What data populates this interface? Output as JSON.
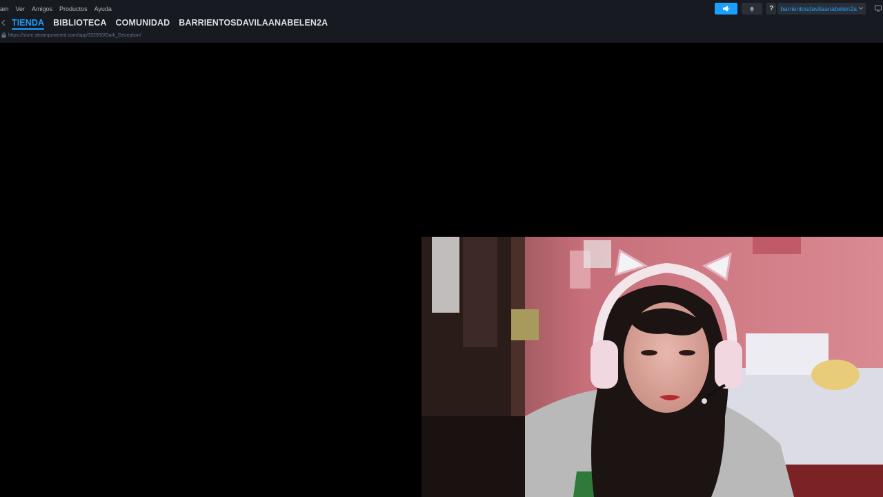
{
  "menu": {
    "items": [
      "am",
      "Ver",
      "Amigos",
      "Productos",
      "Ayuda"
    ]
  },
  "nav": {
    "tabs": [
      {
        "label": "TIENDA",
        "active": true
      },
      {
        "label": "BIBLIOTECA",
        "active": false
      },
      {
        "label": "COMUNIDAD",
        "active": false
      },
      {
        "label": "BARRIENTOSDAVILAANABELEN2A",
        "active": false
      }
    ]
  },
  "url": {
    "text": "https://store.steampowered.com/app/332950/Dark_Deception/"
  },
  "account": {
    "username": "barrientosdavilaanabelen2a",
    "help_label": "?"
  },
  "icons": {
    "announce": "megaphone-icon",
    "notifications": "bell-icon",
    "lock": "lock-icon",
    "back": "back-arrow-icon",
    "big_picture": "monitor-icon"
  },
  "colors": {
    "accent": "#1a9fff",
    "topbar": "#171a21",
    "content_bg": "#000000"
  }
}
